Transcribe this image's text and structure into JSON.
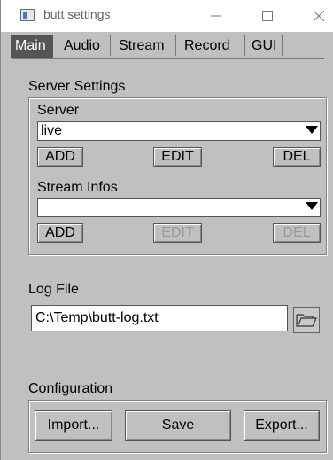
{
  "window": {
    "title": "butt settings"
  },
  "tabs": [
    "Main",
    "Audio",
    "Stream",
    "Record",
    "GUI"
  ],
  "server_settings": {
    "group_label": "Server Settings",
    "server_label": "Server",
    "server_value": "live",
    "add_label": "ADD",
    "edit_label": "EDIT",
    "del_label": "DEL",
    "stream_infos_label": "Stream Infos",
    "stream_infos_value": "",
    "add2_label": "ADD",
    "edit2_label": "EDIT",
    "del2_label": "DEL"
  },
  "log": {
    "label": "Log File",
    "path": "C:\\Temp\\butt-log.txt"
  },
  "config": {
    "label": "Configuration",
    "import_label": "Import...",
    "save_label": "Save",
    "export_label": "Export..."
  }
}
